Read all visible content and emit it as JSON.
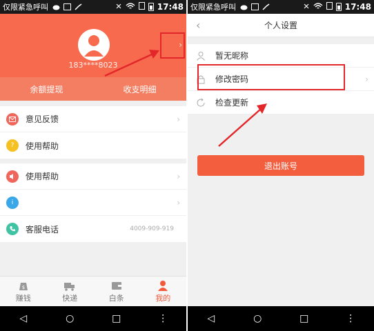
{
  "status_bar": {
    "carrier": "仅限紧急呼叫",
    "time": "17:48"
  },
  "left_screen": {
    "phone_number": "183****8023",
    "chevron": "›",
    "balance_bar": {
      "left": "余额提现",
      "right": "收支明细"
    },
    "menu_group_1": [
      {
        "label": "意见反馈",
        "icon": "mail-icon",
        "color": "#f0665a"
      },
      {
        "label": "使用帮助",
        "icon": "help-icon",
        "color": "#f5c022"
      }
    ],
    "menu_group_2": [
      {
        "label": "使用帮助",
        "icon": "speaker-icon",
        "color": "#f0665a"
      },
      {
        "label": "",
        "icon": "info-icon",
        "color": "#3aa8e8"
      },
      {
        "label": "客服电话",
        "icon": "phone-icon",
        "color": "#40c3a5",
        "value": "4009-909-919"
      }
    ],
    "tabs": [
      {
        "label": "赚钱",
        "icon": "money-bag-icon",
        "active": false
      },
      {
        "label": "快递",
        "icon": "truck-icon",
        "active": false
      },
      {
        "label": "白条",
        "icon": "wallet-icon",
        "active": false
      },
      {
        "label": "我的",
        "icon": "user-icon",
        "active": true
      }
    ]
  },
  "right_screen": {
    "title": "个人设置",
    "back": "‹",
    "items": [
      {
        "label": "暂无昵称",
        "icon": "user-outline-icon"
      },
      {
        "label": "修改密码",
        "icon": "lock-icon"
      },
      {
        "label": "检查更新",
        "icon": "refresh-icon"
      }
    ],
    "logout_label": "退出账号"
  },
  "colors": {
    "accent": "#f86a4e",
    "button": "#f25e3e",
    "annotation_red": "#e3262a"
  }
}
